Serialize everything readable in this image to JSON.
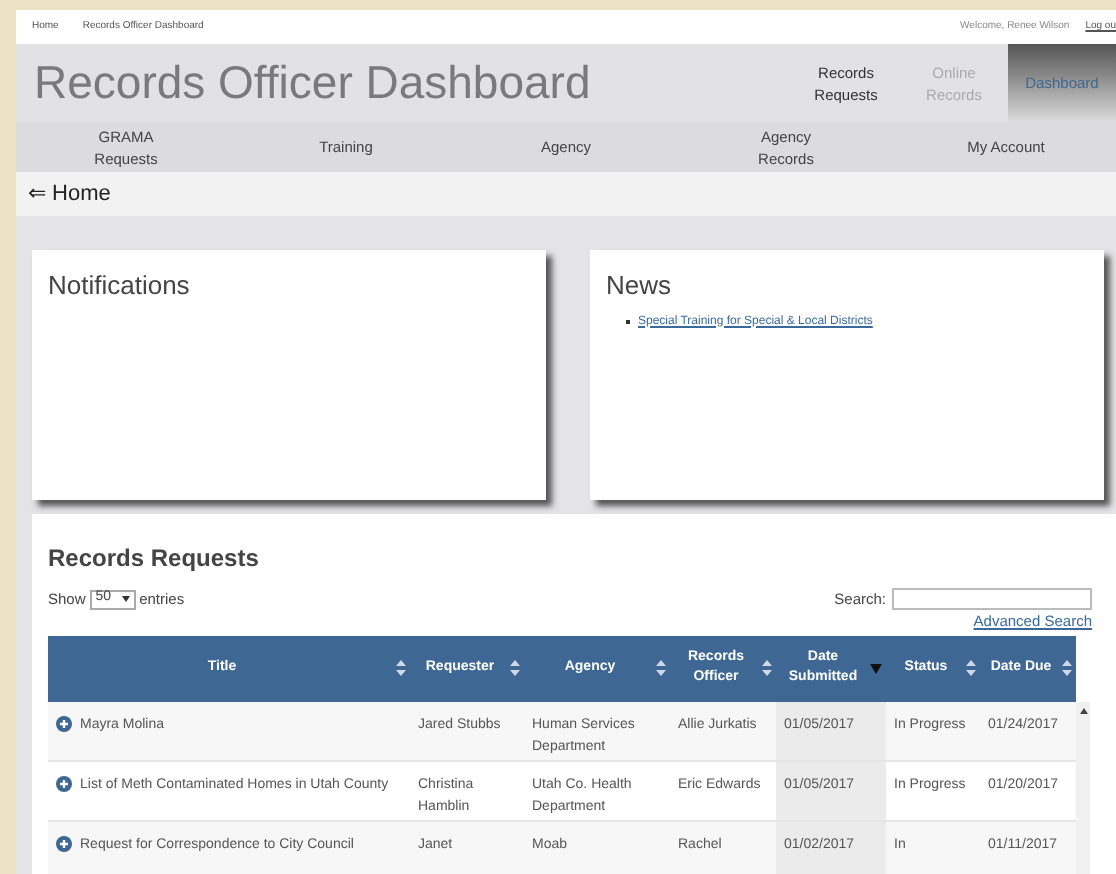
{
  "top_bar": {
    "breadcrumbs": [
      "Home",
      "Records Officer Dashboard"
    ],
    "welcome": "Welcome, Renee Wilson",
    "logout": "Log ou"
  },
  "header": {
    "title": "Records Officer Dashboard",
    "nav": [
      {
        "label": "Records Requests",
        "selected": false,
        "disabled": false
      },
      {
        "label": "Online Records",
        "selected": false,
        "disabled": true
      },
      {
        "label": "Dashboard",
        "selected": true,
        "disabled": false
      }
    ]
  },
  "menu": [
    "GRAMA Requests",
    "Training",
    "Agency",
    "Agency Records",
    "My Account"
  ],
  "back_link": "⇐ Home",
  "notifications": {
    "title": "Notifications"
  },
  "news": {
    "title": "News",
    "items": [
      "Special Training for Special & Local Districts"
    ]
  },
  "records": {
    "title": "Records Requests",
    "show_label": "Show",
    "page_size": "50",
    "entries_label": "entries",
    "search_label": "Search:",
    "advanced_search": "Advanced Search",
    "columns": [
      {
        "label": "Title",
        "sorted": false
      },
      {
        "label": "Requester",
        "sorted": false
      },
      {
        "label": "Agency",
        "sorted": false
      },
      {
        "label": "Records Officer",
        "sorted": false
      },
      {
        "label": "Date Submitted",
        "sorted": true
      },
      {
        "label": "Status",
        "sorted": false
      },
      {
        "label": "Date Due",
        "sorted": false
      }
    ],
    "rows": [
      [
        "Mayra Molina",
        "Jared Stubbs",
        "Human Services Department",
        "Allie Jurkatis",
        "01/05/2017",
        "In Progress",
        "01/24/2017"
      ],
      [
        "List of Meth Contaminated Homes in Utah County",
        "Christina Hamblin",
        "Utah Co. Health Department",
        "Eric Edwards",
        "01/05/2017",
        "In Progress",
        "01/20/2017"
      ],
      [
        "Request for Correspondence to City Council",
        "Janet",
        "Moab",
        "Rachel",
        "01/02/2017",
        "In",
        "01/11/2017"
      ]
    ]
  }
}
